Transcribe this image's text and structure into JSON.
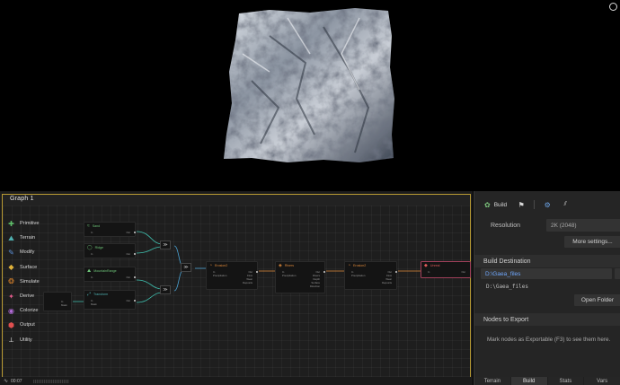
{
  "viewport": {
    "indicator_icon": "circle-outline-icon"
  },
  "graph": {
    "tab_label": "Graph  1",
    "accent_color": "#b89a33",
    "toolbox": [
      {
        "label": "Primitive",
        "icon": "primitive-icon",
        "color": "#5fbf6a"
      },
      {
        "label": "Terrain",
        "icon": "terrain-icon",
        "color": "#4fb0b0"
      },
      {
        "label": "Modify",
        "icon": "modify-icon",
        "color": "#5a8fd6"
      },
      {
        "label": "Surface",
        "icon": "surface-icon",
        "color": "#e0b23a"
      },
      {
        "label": "Simulate",
        "icon": "simulate-icon",
        "color": "#d9822b"
      },
      {
        "label": "Derive",
        "icon": "derive-icon",
        "color": "#e05a8a"
      },
      {
        "label": "Colorize",
        "icon": "colorize-icon",
        "color": "#b06ad6"
      },
      {
        "label": "Output",
        "icon": "output-icon",
        "color": "#e05050"
      },
      {
        "label": "Utility",
        "icon": "utility-icon",
        "color": "#d0d0d0"
      }
    ],
    "nodes": {
      "sand": {
        "title": "Sand",
        "in": "In",
        "out": "Out",
        "color": "#6fc77a"
      },
      "ridge": {
        "title": "Ridge",
        "in": "In",
        "out": "Out",
        "color": "#6fc77a"
      },
      "mountainrange": {
        "title": "MountainRange",
        "in": "In",
        "out": "Out",
        "color": "#6fc77a"
      },
      "transform": {
        "title": "Transform",
        "in": "In",
        "in2": "Mask",
        "out": "Out",
        "color": "#4fb0b0"
      },
      "erosion2a": {
        "title": "Erosion2",
        "in": "In",
        "in2": "Precipitation",
        "outs": [
          "Out",
          "Flow",
          "Wear",
          "Deposits"
        ],
        "color": "#e08a3a"
      },
      "rivers": {
        "title": "Rivers",
        "in": "In",
        "in2": "Precipitation",
        "outs": [
          "Out",
          "Rivers",
          "Depth",
          "Surface",
          "Direction"
        ],
        "color": "#e08a3a"
      },
      "erosion2b": {
        "title": "Erosion2",
        "in": "In",
        "in2": "Precipitation",
        "outs": [
          "Out",
          "Flow",
          "Wear",
          "Deposits"
        ],
        "color": "#e08a3a"
      },
      "unreal": {
        "title": "Unreal",
        "in": "In",
        "out": "Out",
        "color": "#e05a5a"
      },
      "left_stub": {
        "in": "In",
        "in2": "Mask"
      }
    },
    "combine_icon": "combine-icon"
  },
  "side": {
    "tabs": {
      "build_label": "Build",
      "build_icon": "build-icon",
      "flag_icon": "flag-icon",
      "gear_icon": "gear-icon",
      "chart_icon": "chart-icon"
    },
    "resolution_label": "Resolution",
    "resolution_value": "2K (2048)",
    "more_settings": "More settings...",
    "build_destination_label": "Build Destination",
    "destination_value": "D:\\Gaea_files",
    "destination_hint": "D:\\Gaea_files",
    "open_folder": "Open Folder",
    "nodes_to_export": "Nodes to Export",
    "export_hint": "Mark nodes as Exportable (F3) to see them here.",
    "bottom_tabs": [
      "Terrain",
      "Build",
      "Stats",
      "Vars"
    ],
    "active_bottom_tab": "Build"
  },
  "status": {
    "time": "00:07",
    "pulse_icon": "pulse-icon"
  }
}
